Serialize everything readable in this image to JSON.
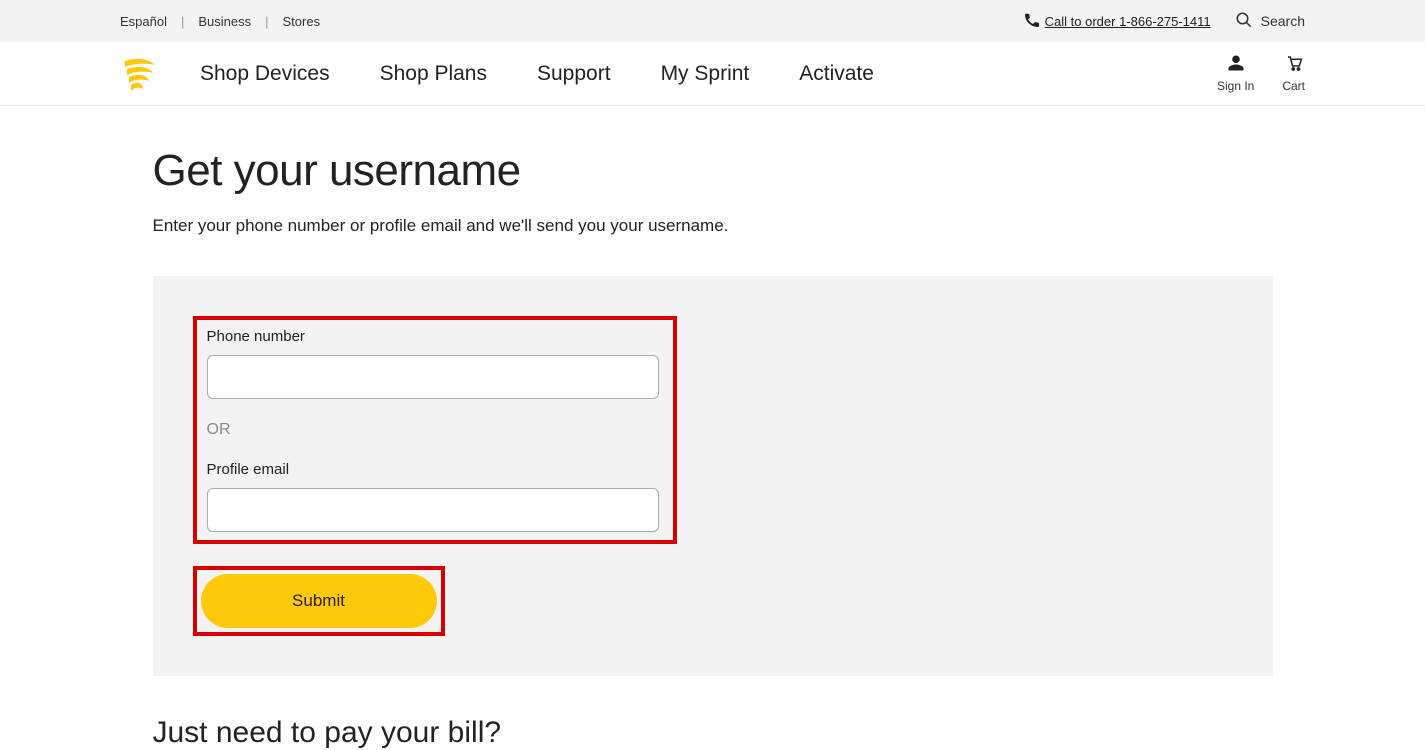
{
  "utility": {
    "links": [
      "Español",
      "Business",
      "Stores"
    ],
    "call_label": "Call to order 1-866-275-1411",
    "search_label": "Search"
  },
  "nav": {
    "items": [
      "Shop Devices",
      "Shop Plans",
      "Support",
      "My Sprint",
      "Activate"
    ],
    "sign_in": "Sign In",
    "cart": "Cart"
  },
  "page": {
    "title": "Get your username",
    "subtitle": "Enter your phone number or profile email and we'll send you your username."
  },
  "form": {
    "phone_label": "Phone number",
    "phone_value": "",
    "or_label": "OR",
    "email_label": "Profile email",
    "email_value": "",
    "submit_label": "Submit"
  },
  "bill": {
    "title": "Just need to pay your bill?"
  }
}
